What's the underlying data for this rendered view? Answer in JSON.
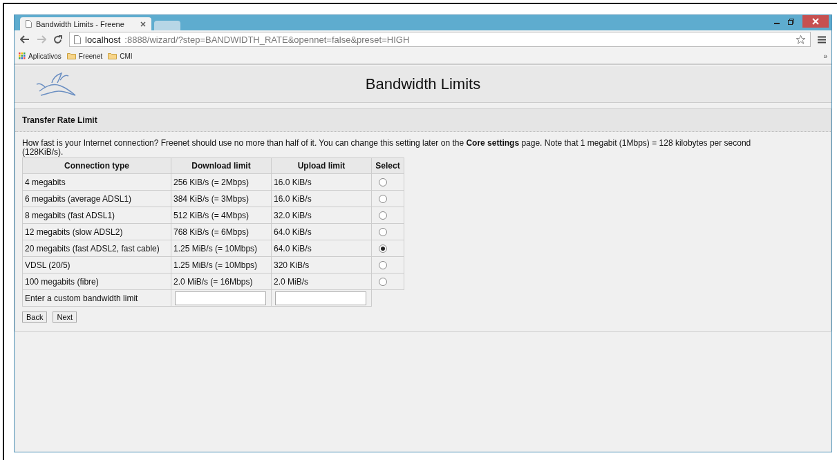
{
  "browser": {
    "tabs": [
      {
        "title": "Bandwidth Limits - Freene",
        "selected": true
      },
      {
        "selected": false
      }
    ],
    "address": {
      "host": "localhost",
      "rest": ":8888/wizard/?step=BANDWIDTH_RATE&opennet=false&preset=HIGH"
    },
    "bookmarks": [
      {
        "label": "Aplicativos",
        "kind": "apps"
      },
      {
        "label": "Freenet",
        "kind": "folder"
      },
      {
        "label": "CMI",
        "kind": "folder"
      }
    ],
    "bookmarks_more": "»"
  },
  "page": {
    "title": "Bandwidth Limits",
    "section": "Transfer Rate Limit",
    "intro": "How fast is your Internet connection? Freenet should use no more than half of it. You can change this setting later on the **Core settings** page. Note that 1 megabit (1Mbps) = 128 kilobytes per second (128KiB/s).",
    "table": {
      "columns": [
        "Connection type",
        "Download limit",
        "Upload limit",
        "Select"
      ],
      "rows": [
        {
          "type": "4 megabits",
          "download": "256 KiB/s (= 2Mbps)",
          "upload": "16.0 KiB/s",
          "selected": false
        },
        {
          "type": "6 megabits (average ADSL1)",
          "download": "384 KiB/s (= 3Mbps)",
          "upload": "16.0 KiB/s",
          "selected": false
        },
        {
          "type": "8 megabits (fast ADSL1)",
          "download": "512 KiB/s (= 4Mbps)",
          "upload": "32.0 KiB/s",
          "selected": false
        },
        {
          "type": "12 megabits (slow ADSL2)",
          "download": "768 KiB/s (= 6Mbps)",
          "upload": "64.0 KiB/s",
          "selected": false
        },
        {
          "type": "20 megabits (fast ADSL2, fast cable)",
          "download": "1.25 MiB/s (= 10Mbps)",
          "upload": "64.0 KiB/s",
          "selected": true
        },
        {
          "type": "VDSL (20/5)",
          "download": "1.25 MiB/s (= 10Mbps)",
          "upload": "320 KiB/s",
          "selected": false
        },
        {
          "type": "100 megabits (fibre)",
          "download": "2.0 MiB/s (= 16Mbps)",
          "upload": "2.0 MiB/s",
          "selected": false
        }
      ],
      "custom_label": "Enter a custom bandwidth limit"
    },
    "buttons": [
      "Back",
      "Next"
    ]
  }
}
